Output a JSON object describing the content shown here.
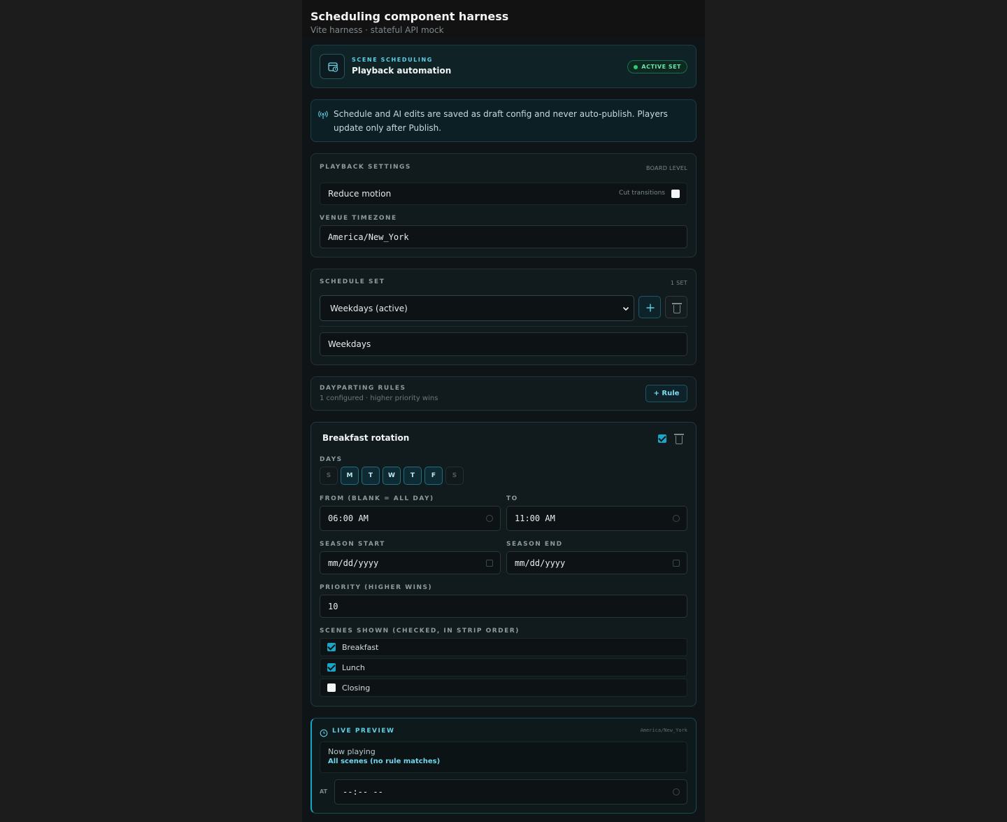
{
  "header": {
    "title": "Scheduling component harness",
    "subtitle": "Vite harness · stateful API mock"
  },
  "top_card": {
    "eyebrow": "SCENE SCHEDULING",
    "title": "Playback automation",
    "badge": "ACTIVE SET",
    "icon": "calendar-clock-icon"
  },
  "notice": {
    "icon": "broadcast-icon",
    "text": "Schedule and AI edits are saved as draft config and never auto-publish. Players update only after Publish."
  },
  "playback": {
    "label": "PLAYBACK SETTINGS",
    "meta": "BOARD LEVEL",
    "reduce_motion": "Reduce motion",
    "cut_transitions": "Cut transitions",
    "cut_checked": false,
    "tz_label": "VENUE TIMEZONE",
    "tz_value": "America/New_York"
  },
  "schedule_set": {
    "label": "SCHEDULE SET",
    "meta": "1 SET",
    "selected": "Weekdays (active)",
    "name_value": "Weekdays"
  },
  "dayparting": {
    "label": "DAYPARTING RULES",
    "sub": "1 configured · higher priority wins",
    "add_button": "+ Rule"
  },
  "rule": {
    "title": "Breakfast rotation",
    "enabled": true,
    "days_label": "DAYS",
    "days": [
      {
        "letter": "S",
        "on": false
      },
      {
        "letter": "M",
        "on": true
      },
      {
        "letter": "T",
        "on": true
      },
      {
        "letter": "W",
        "on": true
      },
      {
        "letter": "T",
        "on": true
      },
      {
        "letter": "F",
        "on": true
      },
      {
        "letter": "S",
        "on": false
      }
    ],
    "from_label": "FROM (BLANK = ALL DAY)",
    "from_value": "06:00 AM",
    "to_label": "TO",
    "to_value": "11:00 AM",
    "season_start_label": "SEASON START",
    "season_start_value": "mm/dd/yyyy",
    "season_end_label": "SEASON END",
    "season_end_value": "mm/dd/yyyy",
    "priority_label": "PRIORITY (HIGHER WINS)",
    "priority_value": "10",
    "scenes_label": "SCENES SHOWN (CHECKED, IN STRIP ORDER)",
    "scenes": [
      {
        "name": "Breakfast",
        "checked": true
      },
      {
        "name": "Lunch",
        "checked": true
      },
      {
        "name": "Closing",
        "checked": false
      }
    ]
  },
  "preview": {
    "label": "LIVE PREVIEW",
    "tz": "America/New_York",
    "now_label": "Now playing",
    "now_value": "All scenes (no rule matches)",
    "at_label": "AT",
    "at_value": "--:-- --"
  },
  "colors": {
    "accent": "#1aa6c8",
    "accent_text": "#5fd0e8",
    "active_green": "#2ecc71",
    "background": "#0f1416"
  }
}
